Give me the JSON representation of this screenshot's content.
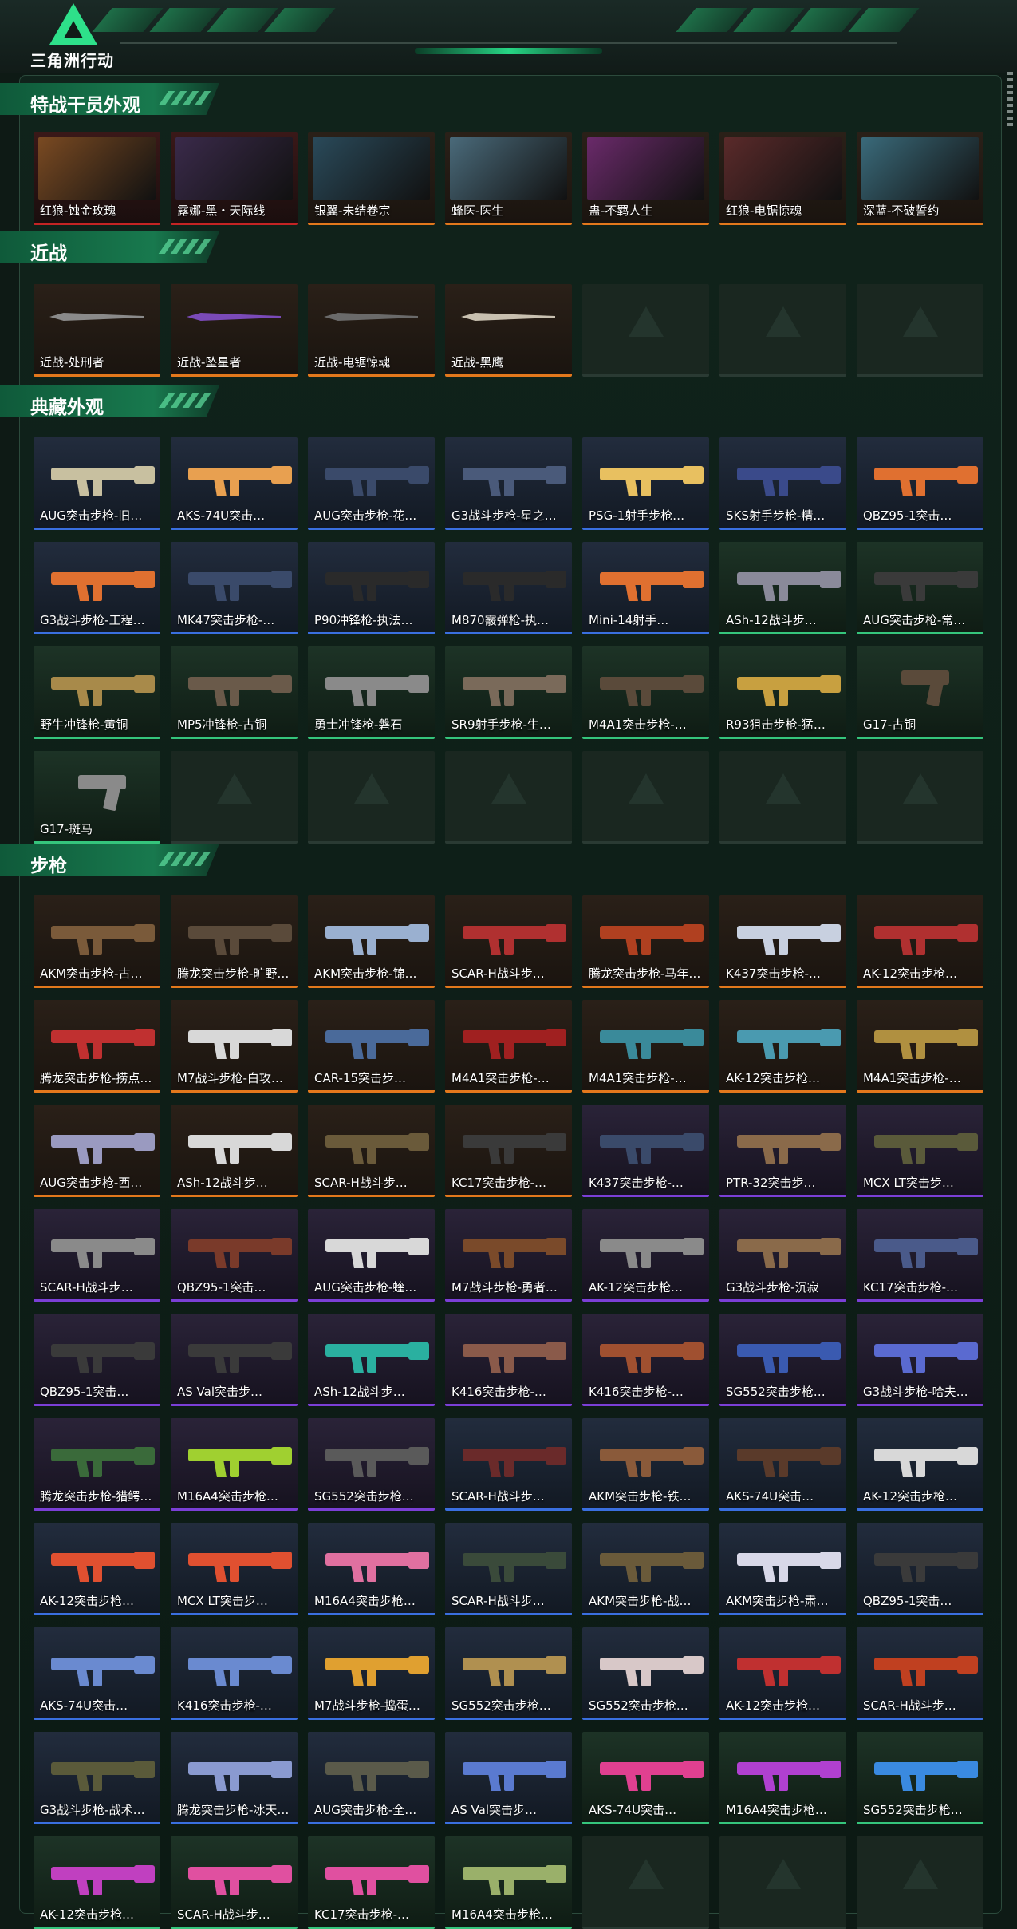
{
  "app": {
    "logo_text": "三角洲行动"
  },
  "colors": {
    "accent": "#2ee08a",
    "rarity_orange": "#e3781c",
    "rarity_red": "#c42424",
    "rarity_purple": "#7b3fd6",
    "rarity_blue": "#3a6fe0",
    "rarity_green": "#35c57c"
  },
  "sections": [
    {
      "title": "特战干员外观",
      "items": [
        {
          "label": "红狼-蚀金玫瑰",
          "rarity": "r-red",
          "kind": "portrait",
          "tone": "#7a4a22"
        },
        {
          "label": "露娜-黑・天际线",
          "rarity": "r-red",
          "kind": "portrait",
          "tone": "#3a2a4a"
        },
        {
          "label": "银翼-未结卷宗",
          "rarity": "r-orange",
          "kind": "portrait",
          "tone": "#2a4a5a"
        },
        {
          "label": "蜂医-医生",
          "rarity": "r-orange",
          "kind": "portrait",
          "tone": "#4a6a7a"
        },
        {
          "label": "蛊-不羁人生",
          "rarity": "r-orange",
          "kind": "portrait",
          "tone": "#6a2a6a"
        },
        {
          "label": "红狼-电锯惊魂",
          "rarity": "r-orange",
          "kind": "portrait",
          "tone": "#5a2a2a"
        },
        {
          "label": "深蓝-不破誓约",
          "rarity": "r-orange",
          "kind": "portrait",
          "tone": "#3a6a7a"
        }
      ]
    },
    {
      "title": "近战",
      "items": [
        {
          "label": "近战-处刑者",
          "rarity": "r-orange",
          "kind": "knife",
          "tone": "#8a8a8a"
        },
        {
          "label": "近战-坠星者",
          "rarity": "r-orange",
          "kind": "knife",
          "tone": "#7a4ab8"
        },
        {
          "label": "近战-电锯惊魂",
          "rarity": "r-orange",
          "kind": "knife",
          "tone": "#6a6a6a"
        },
        {
          "label": "近战-黑鹰",
          "rarity": "r-orange",
          "kind": "knife",
          "tone": "#c8c0b0"
        },
        {
          "label": "",
          "rarity": "empty",
          "kind": "empty",
          "tone": ""
        },
        {
          "label": "",
          "rarity": "empty",
          "kind": "empty",
          "tone": ""
        },
        {
          "label": "",
          "rarity": "empty",
          "kind": "empty",
          "tone": ""
        }
      ]
    },
    {
      "title": "典藏外观",
      "items": [
        {
          "label": "AUG突击步枪-旧…",
          "rarity": "r-blue",
          "kind": "gun",
          "tone": "#c8c0a0"
        },
        {
          "label": "AKS-74U突击…",
          "rarity": "r-blue",
          "kind": "gun",
          "tone": "#e8a050"
        },
        {
          "label": "AUG突击步枪-花…",
          "rarity": "r-blue",
          "kind": "gun",
          "tone": "#3a4a6a"
        },
        {
          "label": "G3战斗步枪-星之…",
          "rarity": "r-blue",
          "kind": "gun",
          "tone": "#4a5a7a"
        },
        {
          "label": "PSG-1射手步枪…",
          "rarity": "r-blue",
          "kind": "gun",
          "tone": "#e8c060"
        },
        {
          "label": "SKS射手步枪-精…",
          "rarity": "r-blue",
          "kind": "gun",
          "tone": "#3a4a8a"
        },
        {
          "label": "QBZ95-1突击…",
          "rarity": "r-blue",
          "kind": "gun",
          "tone": "#e07030"
        },
        {
          "label": "G3战斗步枪-工程…",
          "rarity": "r-blue",
          "kind": "gun",
          "tone": "#e07030"
        },
        {
          "label": "MK47突击步枪-…",
          "rarity": "r-blue",
          "kind": "gun",
          "tone": "#3a4a6a"
        },
        {
          "label": "P90冲锋枪-执法…",
          "rarity": "r-blue",
          "kind": "gun",
          "tone": "#2a2a2a"
        },
        {
          "label": "M870霰弹枪-执…",
          "rarity": "r-blue",
          "kind": "gun",
          "tone": "#2a2a2a"
        },
        {
          "label": "Mini-14射手…",
          "rarity": "r-blue",
          "kind": "gun",
          "tone": "#e07030"
        },
        {
          "label": "ASh-12战斗步…",
          "rarity": "r-green",
          "kind": "gun",
          "tone": "#8a8a9a"
        },
        {
          "label": "AUG突击步枪-常…",
          "rarity": "r-green",
          "kind": "gun",
          "tone": "#3a3a3a"
        },
        {
          "label": "野牛冲锋枪-黄铜",
          "rarity": "r-green",
          "kind": "gun",
          "tone": "#a88a4a"
        },
        {
          "label": "MP5冲锋枪-古铜",
          "rarity": "r-green",
          "kind": "gun",
          "tone": "#6a5a4a"
        },
        {
          "label": "勇士冲锋枪-磐石",
          "rarity": "r-green",
          "kind": "gun",
          "tone": "#8a8a8a"
        },
        {
          "label": "SR9射手步枪-生…",
          "rarity": "r-green",
          "kind": "gun",
          "tone": "#7a6a5a"
        },
        {
          "label": "M4A1突击步枪-…",
          "rarity": "r-green",
          "kind": "gun",
          "tone": "#5a4a3a"
        },
        {
          "label": "R93狙击步枪-猛…",
          "rarity": "r-green",
          "kind": "gun",
          "tone": "#c8a040"
        },
        {
          "label": "G17-古铜",
          "rarity": "r-green",
          "kind": "pistol",
          "tone": "#5a4a3a"
        },
        {
          "label": "G17-斑马",
          "rarity": "r-green",
          "kind": "pistol",
          "tone": "#8a8a8a"
        },
        {
          "label": "",
          "rarity": "empty",
          "kind": "empty",
          "tone": ""
        },
        {
          "label": "",
          "rarity": "empty",
          "kind": "empty",
          "tone": ""
        },
        {
          "label": "",
          "rarity": "empty",
          "kind": "empty",
          "tone": ""
        },
        {
          "label": "",
          "rarity": "empty",
          "kind": "empty",
          "tone": ""
        },
        {
          "label": "",
          "rarity": "empty",
          "kind": "empty",
          "tone": ""
        },
        {
          "label": "",
          "rarity": "empty",
          "kind": "empty",
          "tone": ""
        }
      ]
    },
    {
      "title": "步枪",
      "items": [
        {
          "label": "AKM突击步枪-古…",
          "rarity": "r-orange",
          "kind": "gun",
          "tone": "#7a5a3a"
        },
        {
          "label": "腾龙突击步枪-旷野…",
          "rarity": "r-orange",
          "kind": "gun",
          "tone": "#5a4a3a"
        },
        {
          "label": "AKM突击步枪-锦…",
          "rarity": "r-orange",
          "kind": "gun",
          "tone": "#9ab0d0"
        },
        {
          "label": "SCAR-H战斗步…",
          "rarity": "r-orange",
          "kind": "gun",
          "tone": "#b03030"
        },
        {
          "label": "腾龙突击步枪-马年…",
          "rarity": "r-orange",
          "kind": "gun",
          "tone": "#b04020"
        },
        {
          "label": "K437突击步枪-…",
          "rarity": "r-orange",
          "kind": "gun",
          "tone": "#c8d0e0"
        },
        {
          "label": "AK-12突击步枪…",
          "rarity": "r-orange",
          "kind": "gun",
          "tone": "#b03030"
        },
        {
          "label": "腾龙突击步枪-捞点…",
          "rarity": "r-orange",
          "kind": "gun",
          "tone": "#c03030"
        },
        {
          "label": "M7战斗步枪-白攻…",
          "rarity": "r-orange",
          "kind": "gun",
          "tone": "#d8d8d8"
        },
        {
          "label": "CAR-15突击步…",
          "rarity": "r-orange",
          "kind": "gun",
          "tone": "#4a6a9a"
        },
        {
          "label": "M4A1突击步枪-…",
          "rarity": "r-orange",
          "kind": "gun",
          "tone": "#a02020"
        },
        {
          "label": "M4A1突击步枪-…",
          "rarity": "r-orange",
          "kind": "gun",
          "tone": "#3a8a9a"
        },
        {
          "label": "AK-12突击步枪…",
          "rarity": "r-orange",
          "kind": "gun",
          "tone": "#4a9ab0"
        },
        {
          "label": "M4A1突击步枪-…",
          "rarity": "r-orange",
          "kind": "gun",
          "tone": "#b09040"
        },
        {
          "label": "AUG突击步枪-西…",
          "rarity": "r-orange",
          "kind": "gun",
          "tone": "#9a9ac0"
        },
        {
          "label": "ASh-12战斗步…",
          "rarity": "r-orange",
          "kind": "gun",
          "tone": "#d8d8d8"
        },
        {
          "label": "SCAR-H战斗步…",
          "rarity": "r-orange",
          "kind": "gun",
          "tone": "#6a5a3a"
        },
        {
          "label": "KC17突击步枪-…",
          "rarity": "r-orange",
          "kind": "gun",
          "tone": "#3a3a3a"
        },
        {
          "label": "K437突击步枪-…",
          "rarity": "r-purple",
          "kind": "gun",
          "tone": "#3a4a6a"
        },
        {
          "label": "PTR-32突击步…",
          "rarity": "r-purple",
          "kind": "gun",
          "tone": "#8a6a4a"
        },
        {
          "label": "MCX LT突击步…",
          "rarity": "r-purple",
          "kind": "gun",
          "tone": "#5a5a3a"
        },
        {
          "label": "SCAR-H战斗步…",
          "rarity": "r-purple",
          "kind": "gun",
          "tone": "#8a8a8a"
        },
        {
          "label": "QBZ95-1突击…",
          "rarity": "r-purple",
          "kind": "gun",
          "tone": "#7a3a2a"
        },
        {
          "label": "AUG突击步枪-蝰…",
          "rarity": "r-purple",
          "kind": "gun",
          "tone": "#d8d8d8"
        },
        {
          "label": "M7战斗步枪-勇者…",
          "rarity": "r-purple",
          "kind": "gun",
          "tone": "#7a4a2a"
        },
        {
          "label": "AK-12突击步枪…",
          "rarity": "r-purple",
          "kind": "gun",
          "tone": "#8a8a8a"
        },
        {
          "label": "G3战斗步枪-沉寂",
          "rarity": "r-purple",
          "kind": "gun",
          "tone": "#8a6a4a"
        },
        {
          "label": "KC17突击步枪-…",
          "rarity": "r-purple",
          "kind": "gun",
          "tone": "#4a5a8a"
        },
        {
          "label": "QBZ95-1突击…",
          "rarity": "r-purple",
          "kind": "gun",
          "tone": "#3a3a3a"
        },
        {
          "label": "AS Val突击步…",
          "rarity": "r-purple",
          "kind": "gun",
          "tone": "#3a3a3a"
        },
        {
          "label": "ASh-12战斗步…",
          "rarity": "r-purple",
          "kind": "gun",
          "tone": "#2ab0a0"
        },
        {
          "label": "K416突击步枪-…",
          "rarity": "r-purple",
          "kind": "gun",
          "tone": "#8a5a4a"
        },
        {
          "label": "K416突击步枪-…",
          "rarity": "r-purple",
          "kind": "gun",
          "tone": "#a05030"
        },
        {
          "label": "SG552突击步枪…",
          "rarity": "r-purple",
          "kind": "gun",
          "tone": "#3a5ab0"
        },
        {
          "label": "G3战斗步枪-哈夫…",
          "rarity": "r-purple",
          "kind": "gun",
          "tone": "#5a6ad0"
        },
        {
          "label": "腾龙突击步枪-猎鳄…",
          "rarity": "r-purple",
          "kind": "gun",
          "tone": "#3a6a3a"
        },
        {
          "label": "M16A4突击步枪…",
          "rarity": "r-purple",
          "kind": "gun",
          "tone": "#a0d030"
        },
        {
          "label": "SG552突击步枪…",
          "rarity": "r-purple",
          "kind": "gun",
          "tone": "#5a5a5a"
        },
        {
          "label": "SCAR-H战斗步…",
          "rarity": "r-blue",
          "kind": "gun",
          "tone": "#6a2a2a"
        },
        {
          "label": "AKM突击步枪-铁…",
          "rarity": "r-blue",
          "kind": "gun",
          "tone": "#8a5a3a"
        },
        {
          "label": "AKS-74U突击…",
          "rarity": "r-blue",
          "kind": "gun",
          "tone": "#5a3a2a"
        },
        {
          "label": "AK-12突击步枪…",
          "rarity": "r-blue",
          "kind": "gun",
          "tone": "#d8d8d8"
        },
        {
          "label": "AK-12突击步枪…",
          "rarity": "r-blue",
          "kind": "gun",
          "tone": "#e05030"
        },
        {
          "label": "MCX LT突击步…",
          "rarity": "r-blue",
          "kind": "gun",
          "tone": "#e05030"
        },
        {
          "label": "M16A4突击步枪…",
          "rarity": "r-blue",
          "kind": "gun",
          "tone": "#e070a0"
        },
        {
          "label": "SCAR-H战斗步…",
          "rarity": "r-blue",
          "kind": "gun",
          "tone": "#3a4a3a"
        },
        {
          "label": "AKM突击步枪-战…",
          "rarity": "r-blue",
          "kind": "gun",
          "tone": "#6a5a3a"
        },
        {
          "label": "AKM突击步枪-肃…",
          "rarity": "r-blue",
          "kind": "gun",
          "tone": "#d8d8e8"
        },
        {
          "label": "QBZ95-1突击…",
          "rarity": "r-blue",
          "kind": "gun",
          "tone": "#3a3a3a"
        },
        {
          "label": "AKS-74U突击…",
          "rarity": "r-blue",
          "kind": "gun",
          "tone": "#6a8ad0"
        },
        {
          "label": "K416突击步枪-…",
          "rarity": "r-blue",
          "kind": "gun",
          "tone": "#6a8ad0"
        },
        {
          "label": "M7战斗步枪-捣蛋…",
          "rarity": "r-blue",
          "kind": "gun",
          "tone": "#e0a030"
        },
        {
          "label": "SG552突击步枪…",
          "rarity": "r-blue",
          "kind": "gun",
          "tone": "#b09050"
        },
        {
          "label": "SG552突击步枪…",
          "rarity": "r-blue",
          "kind": "gun",
          "tone": "#d8c8c8"
        },
        {
          "label": "AK-12突击步枪…",
          "rarity": "r-blue",
          "kind": "gun",
          "tone": "#c03030"
        },
        {
          "label": "SCAR-H战斗步…",
          "rarity": "r-blue",
          "kind": "gun",
          "tone": "#c04020"
        },
        {
          "label": "G3战斗步枪-战术…",
          "rarity": "r-blue",
          "kind": "gun",
          "tone": "#5a5a3a"
        },
        {
          "label": "腾龙突击步枪-冰天…",
          "rarity": "r-blue",
          "kind": "gun",
          "tone": "#8a9ad0"
        },
        {
          "label": "AUG突击步枪-全…",
          "rarity": "r-blue",
          "kind": "gun",
          "tone": "#5a5a4a"
        },
        {
          "label": "AS Val突击步…",
          "rarity": "r-blue",
          "kind": "gun",
          "tone": "#5a7ad0"
        },
        {
          "label": "AKS-74U突击…",
          "rarity": "r-green",
          "kind": "gun",
          "tone": "#e04090"
        },
        {
          "label": "M16A4突击步枪…",
          "rarity": "r-green",
          "kind": "gun",
          "tone": "#b040d0"
        },
        {
          "label": "SG552突击步枪…",
          "rarity": "r-green",
          "kind": "gun",
          "tone": "#3a8ae0"
        },
        {
          "label": "AK-12突击步枪…",
          "rarity": "r-green",
          "kind": "gun",
          "tone": "#c040c0"
        },
        {
          "label": "SCAR-H战斗步…",
          "rarity": "r-green",
          "kind": "gun",
          "tone": "#e050a0"
        },
        {
          "label": "KC17突击步枪-…",
          "rarity": "r-green",
          "kind": "gun",
          "tone": "#e050a0"
        },
        {
          "label": "M16A4突击步枪…",
          "rarity": "r-green",
          "kind": "gun",
          "tone": "#9ab06a"
        },
        {
          "label": "",
          "rarity": "empty",
          "kind": "empty",
          "tone": ""
        },
        {
          "label": "",
          "rarity": "empty",
          "kind": "empty",
          "tone": ""
        },
        {
          "label": "",
          "rarity": "empty",
          "kind": "empty",
          "tone": ""
        }
      ]
    }
  ]
}
